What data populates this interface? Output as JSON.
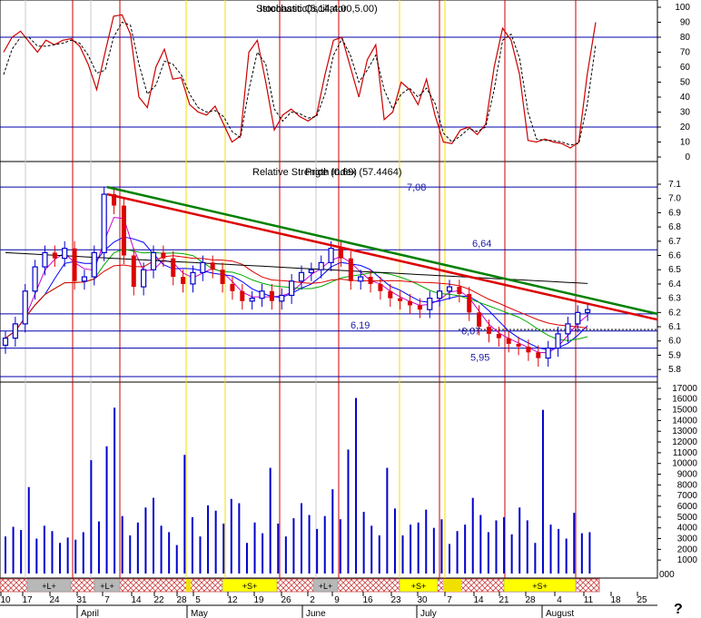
{
  "chart_data": [
    {
      "type": "line",
      "panel": "stochastic-oscillator",
      "title": "Stochastic Oscillator",
      "overlay_text": "Istochastic(5,14,4.00,5.00)",
      "ylim": [
        0,
        100
      ],
      "y_ticks": [
        "100",
        "90",
        "80",
        "70",
        "60",
        "50",
        "40",
        "30",
        "20",
        "10",
        "0"
      ],
      "reference_lines": [
        80,
        20
      ],
      "series": [
        {
          "color": "#cc0000",
          "style": "solid",
          "values": [
            70,
            80,
            84,
            77,
            70,
            78,
            75,
            78,
            79,
            74,
            62,
            45,
            70,
            94,
            95,
            82,
            40,
            33,
            60,
            72,
            52,
            53,
            35,
            30,
            28,
            34,
            22,
            10,
            14,
            70,
            78,
            50,
            18,
            28,
            32,
            27,
            24,
            28,
            55,
            78,
            80,
            60,
            40,
            65,
            75,
            25,
            30,
            50,
            45,
            35,
            52,
            28,
            10,
            9,
            18,
            20,
            15,
            22,
            60,
            86,
            78,
            55,
            11,
            10,
            12,
            10,
            9,
            6,
            10,
            55,
            90
          ]
        },
        {
          "color": "#000000",
          "style": "dashed",
          "values": [
            55,
            72,
            80,
            80,
            74,
            74,
            75,
            76,
            78,
            76,
            68,
            56,
            58,
            80,
            90,
            88,
            62,
            42,
            48,
            64,
            62,
            55,
            42,
            33,
            30,
            31,
            27,
            17,
            13,
            45,
            70,
            62,
            32,
            24,
            30,
            29,
            26,
            27,
            42,
            68,
            79,
            68,
            50,
            58,
            68,
            45,
            32,
            42,
            46,
            40,
            46,
            36,
            16,
            10,
            14,
            19,
            17,
            20,
            45,
            78,
            82,
            66,
            30,
            12,
            11,
            11,
            10,
            8,
            9,
            35,
            75
          ]
        }
      ]
    },
    {
      "type": "candlestick",
      "panel": "price",
      "title": "Relative Strength Index (57.4464)",
      "overlay_text": "Price (0.69)",
      "ylim": [
        5.7,
        7.15
      ],
      "y_ticks": [
        "7.1",
        "7.0",
        "6.9",
        "6.8",
        "6.7",
        "6.6",
        "6.5",
        "6.4",
        "6.3",
        "6.2",
        "6.1",
        "6.0",
        "5.9",
        "5.8"
      ],
      "level_labels": [
        "7,08",
        "6,64",
        "6,19",
        "6,07",
        "5,95"
      ],
      "reference_lines": [
        7.08,
        6.64,
        6.19,
        6.07,
        5.95,
        5.75
      ],
      "trendlines": [
        {
          "color": "#008000",
          "from": [
            6.1,
            7.08
          ],
          "to": [
            25.9,
            6.19
          ]
        },
        {
          "color": "#dd0000",
          "from": [
            6.1,
            7.03
          ],
          "to": [
            25.9,
            6.15
          ]
        }
      ],
      "closes": [
        6.02,
        6.12,
        6.35,
        6.52,
        6.62,
        6.58,
        6.65,
        6.42,
        6.45,
        6.62,
        7.03,
        6.95,
        6.6,
        6.38,
        6.5,
        6.62,
        6.58,
        6.45,
        6.4,
        6.48,
        6.55,
        6.5,
        6.4,
        6.35,
        6.28,
        6.3,
        6.35,
        6.28,
        6.32,
        6.42,
        6.48,
        6.5,
        6.55,
        6.65,
        6.58,
        6.42,
        6.45,
        6.4,
        6.35,
        6.3,
        6.28,
        6.25,
        6.22,
        6.3,
        6.35,
        6.38,
        6.33,
        6.2,
        6.1,
        6.05,
        6.02,
        5.98,
        5.96,
        5.92,
        5.88,
        5.95,
        6.05,
        6.12,
        6.2,
        6.22
      ]
    },
    {
      "type": "bar",
      "panel": "volume",
      "ylim": [
        0,
        17500
      ],
      "y_ticks": [
        "17000",
        "16000",
        "15000",
        "14000",
        "13000",
        "12000",
        "11000",
        "10000",
        "9000",
        "8000",
        "7000",
        "6000",
        "5000",
        "4000",
        "3000",
        "2000",
        "1000"
      ],
      "values": [
        3200,
        4100,
        3800,
        7800,
        3000,
        4200,
        3700,
        2600,
        3100,
        2900,
        3600,
        10300,
        4600,
        11600,
        15200,
        5100,
        3300,
        4500,
        5900,
        6800,
        4200,
        3600,
        2400,
        10800,
        5000,
        3200,
        6100,
        5600,
        4400,
        6700,
        6300,
        2600,
        4500,
        3500,
        9600,
        4400,
        3200,
        4900,
        6300,
        5200,
        3900,
        5100,
        7600,
        4800,
        11300,
        16100,
        5500,
        4200,
        3300,
        9600,
        5800,
        3300,
        4300,
        4500,
        5700,
        4000,
        4800,
        2500,
        3700,
        4300,
        6800,
        5200,
        3600,
        4700,
        5000,
        3400,
        5900,
        4700,
        2600,
        15000,
        4300,
        3900,
        3000,
        5400,
        3500,
        3600
      ]
    }
  ],
  "event_bands": [
    {
      "text": "+L+",
      "color": "#b8b8b8"
    },
    {
      "text": "+L+",
      "color": "#b8b8b8"
    },
    {
      "text": "+S+",
      "color": "#ffff00"
    },
    {
      "text": "+L+",
      "color": "#b8b8b8"
    },
    {
      "text": "+S+",
      "color": "#ffff00"
    },
    {
      "text": "+S+",
      "color": "#ffff00"
    }
  ],
  "x_axis": {
    "day_labels": [
      "10",
      "17",
      "24",
      "31",
      "7",
      "14",
      "22",
      "28",
      "5",
      "12",
      "19",
      "26",
      "2",
      "9",
      "16",
      "23",
      "30",
      "7",
      "14",
      "21",
      "28",
      "4",
      "11",
      "18",
      "25"
    ],
    "month_labels": [
      "April",
      "May",
      "June",
      "July",
      "August"
    ],
    "corner_label": "?",
    "volume_bottom_label": "000"
  },
  "colors": {
    "up_candle": "#0000cc",
    "down_candle": "#dd0000",
    "grid_blue": "#0000aa",
    "red_marker": "#cc0000",
    "yellow_marker": "#f0e000",
    "ma_black": "#000000",
    "ma_red": "#dd0000",
    "ma_green": "#00aa00",
    "ma_blue": "#0000ff",
    "ma_magenta": "#cc00cc"
  }
}
